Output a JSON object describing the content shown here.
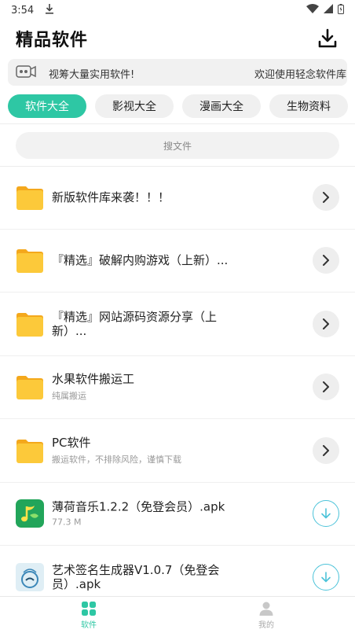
{
  "status_bar": {
    "time": "3:54"
  },
  "header": {
    "title": "精品软件"
  },
  "notice": {
    "text_a": "视筹大量实用软件!",
    "text_b": "欢迎使用轻念软件库"
  },
  "tabs": [
    {
      "label": "软件大全",
      "active": true
    },
    {
      "label": "影视大全",
      "active": false
    },
    {
      "label": "漫画大全",
      "active": false
    },
    {
      "label": "生物资料",
      "active": false
    }
  ],
  "search": {
    "placeholder": "搜文件"
  },
  "list": [
    {
      "title": "新版软件库来袭！！！",
      "subtitle": "",
      "icon": "folder-icon",
      "action": "arrow"
    },
    {
      "title": "『精选』破解内购游戏（上新）...",
      "subtitle": "",
      "icon": "folder-icon",
      "action": "arrow"
    },
    {
      "title": "『精选』网站源码资源分享（上新）...",
      "subtitle": "",
      "icon": "folder-icon",
      "action": "arrow"
    },
    {
      "title": "水果软件搬运工",
      "subtitle": "纯属搬运",
      "icon": "folder-icon",
      "action": "arrow"
    },
    {
      "title": "PC软件",
      "subtitle": "搬运软件，不排除风险，谨慎下载",
      "icon": "folder-icon",
      "action": "arrow"
    },
    {
      "title": "薄荷音乐1.2.2（免登会员）.apk",
      "subtitle": "77.3 M",
      "icon": "music-app-icon",
      "action": "download"
    },
    {
      "title": "艺术签名生成器V1.0.7（免登会员）.apk",
      "subtitle": "",
      "icon": "signature-app-icon",
      "action": "download"
    }
  ],
  "bottom_nav": [
    {
      "label": "软件",
      "icon": "grid-icon",
      "active": true
    },
    {
      "label": "我的",
      "icon": "user-icon",
      "active": false
    }
  ],
  "colors": {
    "accent": "#2ec7a4",
    "folder": "#fbc531",
    "download_ring": "#4cc3d9"
  }
}
